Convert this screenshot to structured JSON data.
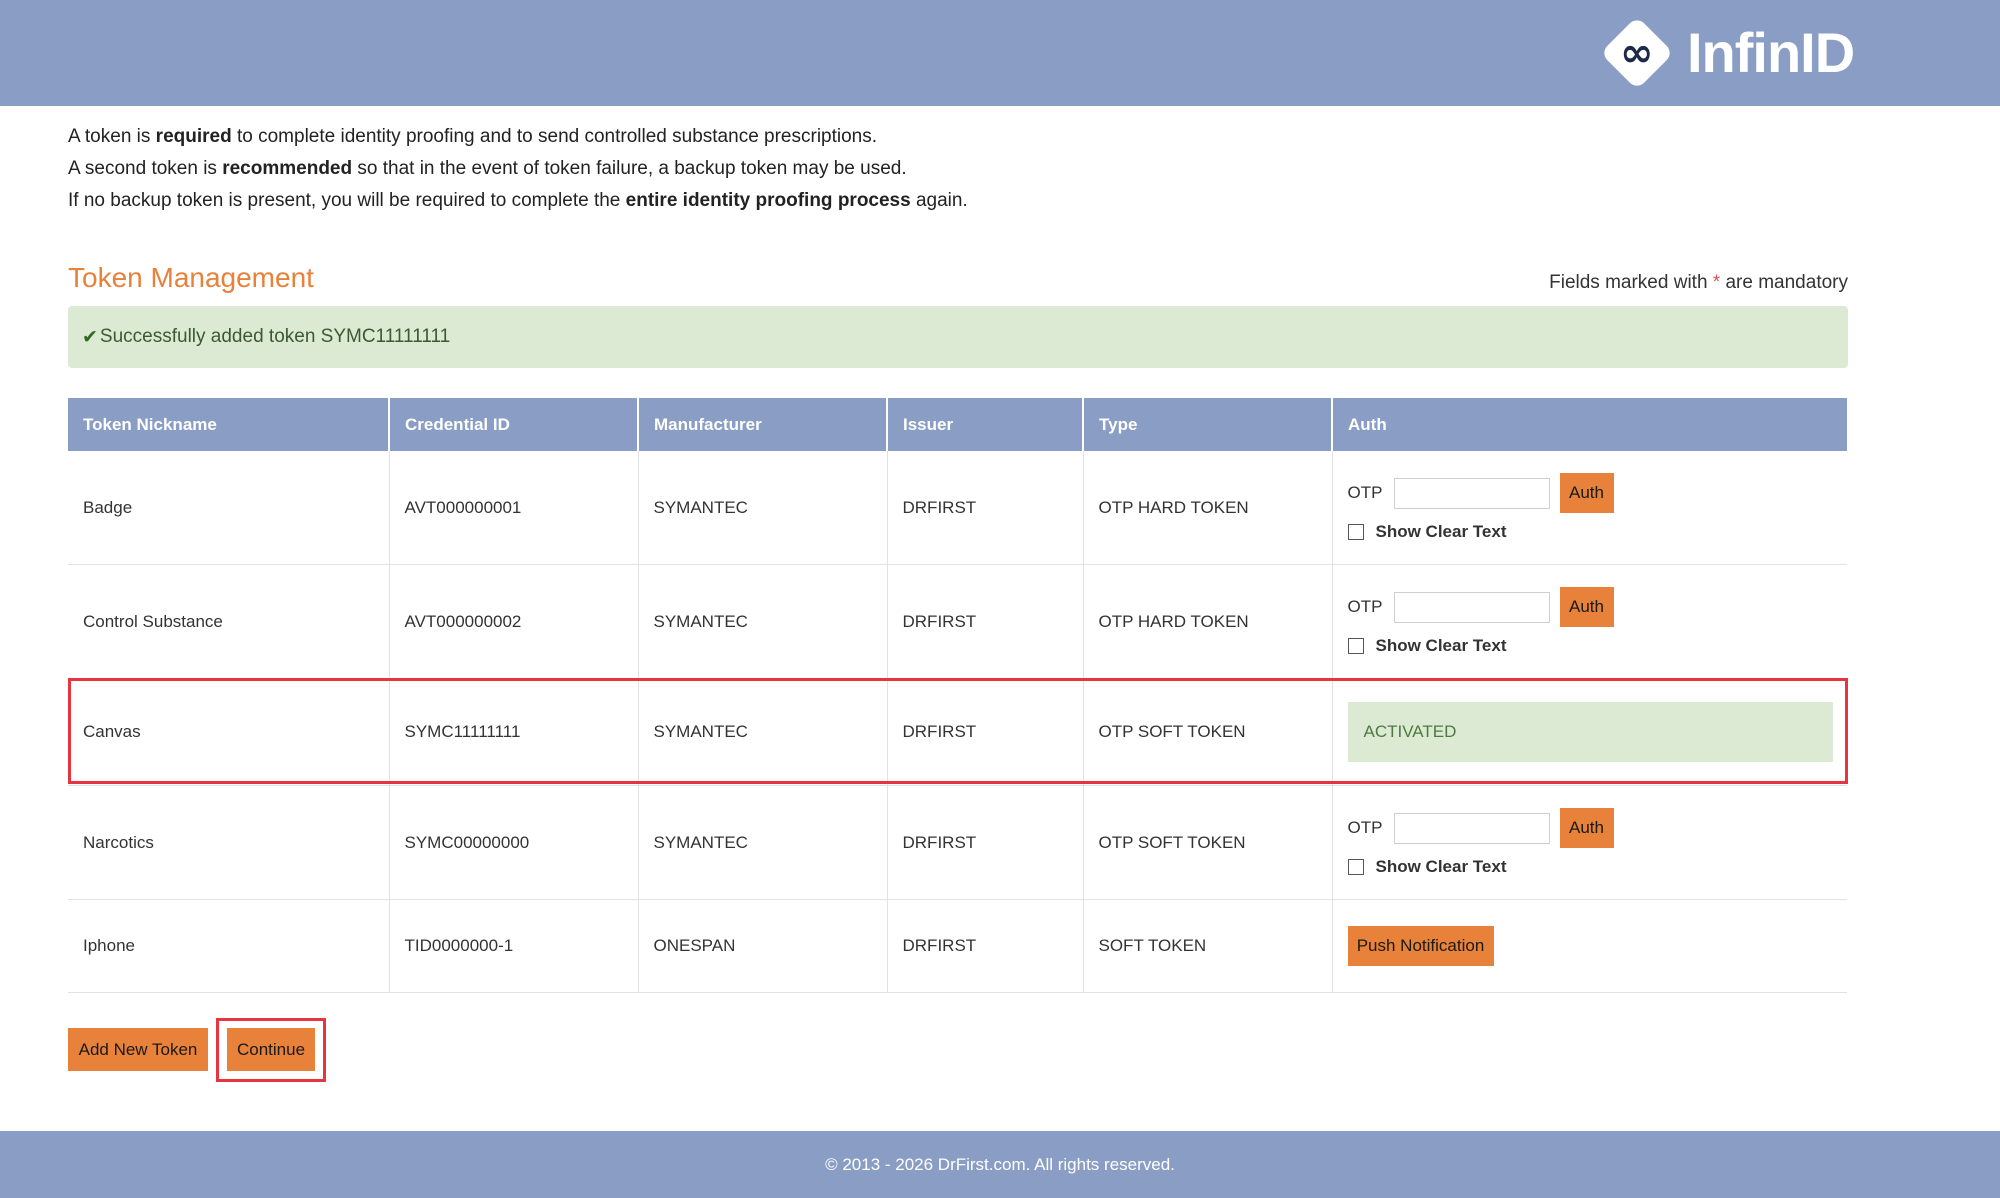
{
  "header": {
    "logo_symbol": "∞",
    "logo_text": "InfinID",
    "bg_color": "#8a9dc4"
  },
  "intro": {
    "line1": {
      "pre": "A token is ",
      "bold": "required",
      "post": " to complete identity proofing and to send controlled substance prescriptions."
    },
    "line2": {
      "pre": "A second token is ",
      "bold": "recommended",
      "post": " so that in the event of token failure, a backup token may be used."
    },
    "line3": {
      "pre": "If no backup token is present, you will be required to complete the ",
      "bold": "entire identity proofing process",
      "post": " again."
    }
  },
  "section": {
    "title": "Token Management",
    "mandatory_pre": "Fields marked with ",
    "mandatory_star": "*",
    "mandatory_post": " are mandatory"
  },
  "alert": {
    "icon": "✔",
    "message": "Successfully added token SYMC11111111"
  },
  "table": {
    "headers": [
      "Token Nickname",
      "Credential ID",
      "Manufacturer",
      "Issuer",
      "Type",
      "Auth"
    ],
    "rows": [
      {
        "nickname": "Badge",
        "credential_id": "AVT000000001",
        "manufacturer": "SYMANTEC",
        "issuer": "DRFIRST",
        "type": "OTP HARD TOKEN",
        "otp_label": "OTP",
        "otp_value": "",
        "auth_label": "Auth",
        "show_clear_text": "Show Clear Text"
      },
      {
        "nickname": "Control Substance",
        "credential_id": "AVT000000002",
        "manufacturer": "SYMANTEC",
        "issuer": "DRFIRST",
        "type": "OTP HARD TOKEN",
        "otp_label": "OTP",
        "otp_value": "",
        "auth_label": "Auth",
        "show_clear_text": "Show Clear Text"
      },
      {
        "nickname": "Canvas",
        "credential_id": "SYMC11111111",
        "manufacturer": "SYMANTEC",
        "issuer": "DRFIRST",
        "type": "OTP SOFT TOKEN",
        "status": "ACTIVATED"
      },
      {
        "nickname": "Narcotics",
        "credential_id": "SYMC00000000",
        "manufacturer": "SYMANTEC",
        "issuer": "DRFIRST",
        "type": "OTP SOFT TOKEN",
        "otp_label": "OTP",
        "otp_value": "",
        "auth_label": "Auth",
        "show_clear_text": "Show Clear Text"
      },
      {
        "nickname": "Iphone",
        "credential_id": "TID0000000-1",
        "manufacturer": "ONESPAN",
        "issuer": "DRFIRST",
        "type": "SOFT TOKEN",
        "push_label": "Push Notification"
      }
    ]
  },
  "actions": {
    "add_new_token": "Add New Token",
    "continue": "Continue"
  },
  "footer": {
    "copyright": "© 2013 - 2026 DrFirst.com. All rights reserved."
  },
  "colors": {
    "accent": "#e8813a",
    "success_bg": "#dcead3",
    "highlight": "#e53540"
  }
}
